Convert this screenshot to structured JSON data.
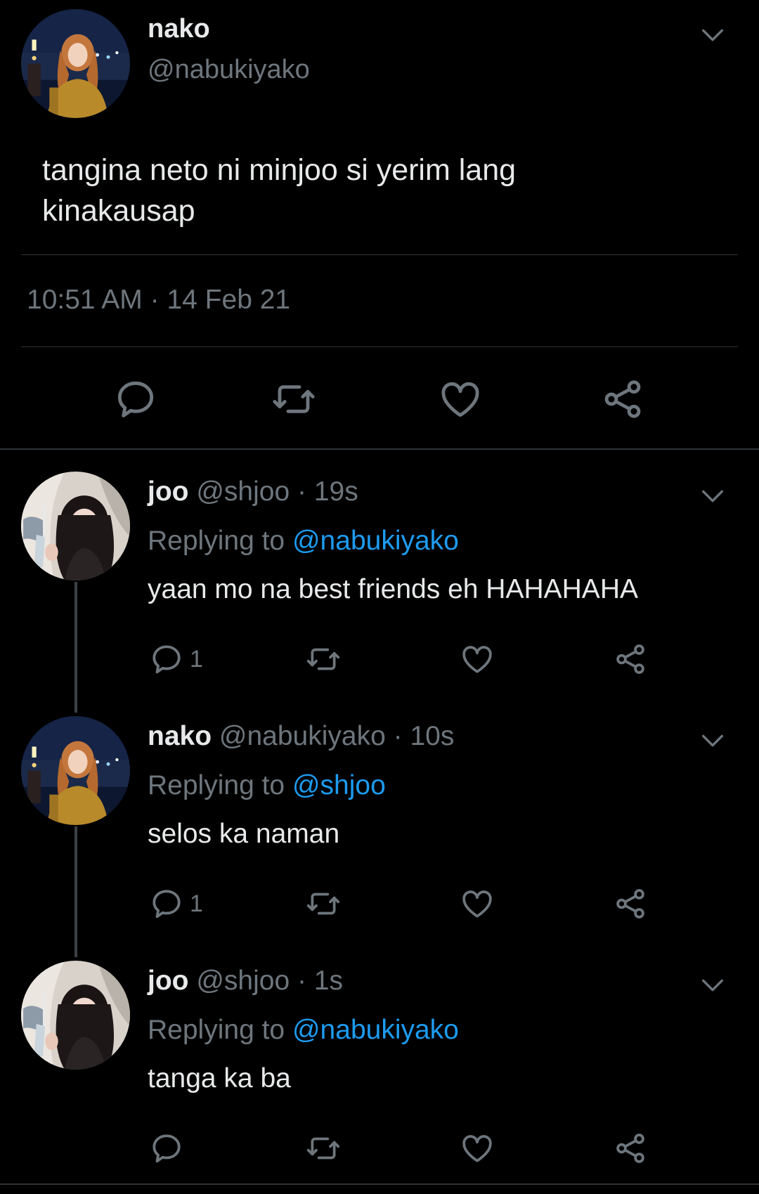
{
  "main_tweet": {
    "display_name": "nako",
    "handle": "@nabukiyako",
    "text_line1": "tangina neto ni minjoo si yerim lang",
    "text_line2": "kinakausap",
    "time": "10:51 AM",
    "separator": "·",
    "date": "14 Feb 21",
    "actions": [
      "reply-icon",
      "retweet-icon",
      "like-icon",
      "share-icon"
    ]
  },
  "replies": [
    {
      "display_name": "joo",
      "handle": "@shjoo",
      "sep": "·",
      "time": "19s",
      "replying_label": "Replying to",
      "replying_to": "@nabukiyako",
      "text": "yaan mo na best friends eh HAHAHAHA",
      "reply_count": "1"
    },
    {
      "display_name": "nako",
      "handle": "@nabukiyako",
      "sep": "·",
      "time": "10s",
      "replying_label": "Replying to",
      "replying_to": "@shjoo",
      "text": "selos ka naman",
      "reply_count": "1"
    },
    {
      "display_name": "joo",
      "handle": "@shjoo",
      "sep": "·",
      "time": "1s",
      "replying_label": "Replying to",
      "replying_to": "@nabukiyako",
      "text": "tanga ka ba",
      "reply_count": ""
    }
  ],
  "colors": {
    "background": "#000000",
    "text": "#e7e9ea",
    "muted": "#6e767d",
    "link": "#1d9bf0",
    "divider": "#2f3336"
  }
}
